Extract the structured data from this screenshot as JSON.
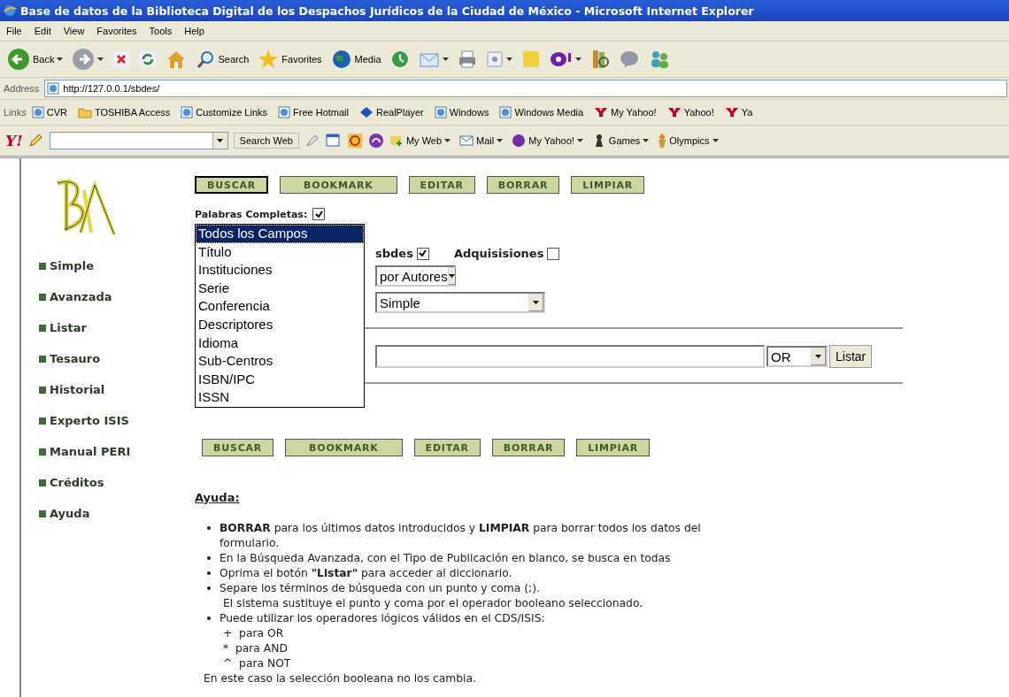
{
  "window": {
    "title": "Base de datos de la Biblioteca Digital de los Despachos Jurídicos de la Ciudad de México - Microsoft Internet Explorer"
  },
  "menu": [
    "File",
    "Edit",
    "View",
    "Favorites",
    "Tools",
    "Help"
  ],
  "toolbar": [
    {
      "kind": "back",
      "label": "Back",
      "dropdown": true
    },
    {
      "kind": "forward",
      "dropdown": true
    },
    {
      "kind": "stop"
    },
    {
      "kind": "refresh"
    },
    {
      "kind": "home"
    },
    {
      "kind": "search",
      "label": "Search"
    },
    {
      "kind": "favorites",
      "label": "Favorites"
    },
    {
      "kind": "media",
      "label": "Media"
    },
    {
      "kind": "history"
    },
    {
      "kind": "mail",
      "dropdown": true
    },
    {
      "kind": "print"
    },
    {
      "kind": "edit",
      "dropdown": true
    },
    {
      "kind": "note"
    },
    {
      "kind": "messenger",
      "dropdown": true
    },
    {
      "kind": "research"
    },
    {
      "kind": "discuss"
    },
    {
      "kind": "contacts"
    }
  ],
  "address": {
    "label": "Address",
    "value": "http://127.0.0.1/sbdes/"
  },
  "links": {
    "label": "Links",
    "items": [
      {
        "kind": "page",
        "label": "CVR"
      },
      {
        "kind": "folder",
        "label": "TOSHIBA Access"
      },
      {
        "kind": "page",
        "label": "Customize Links"
      },
      {
        "kind": "page",
        "label": "Free Hotmail"
      },
      {
        "kind": "real",
        "label": "RealPlayer"
      },
      {
        "kind": "page",
        "label": "Windows"
      },
      {
        "kind": "page",
        "label": "Windows Media"
      },
      {
        "kind": "yahoo",
        "label": "My Yahoo!"
      },
      {
        "kind": "yahoo",
        "label": "Yahoo!"
      },
      {
        "kind": "yahoo",
        "label": "Ya"
      }
    ]
  },
  "yahoo_bar": {
    "logo": "Y!",
    "search_button": "Search Web",
    "items": [
      {
        "kind": "myweb",
        "label": "My Web"
      },
      {
        "kind": "mail",
        "label": "Mail"
      },
      {
        "kind": "my",
        "label": "My Yahoo!"
      },
      {
        "kind": "games",
        "label": "Games"
      },
      {
        "kind": "olympics",
        "label": "Olympics"
      }
    ]
  },
  "nav": [
    "Simple",
    "Avanzada",
    "Listar",
    "Tesauro",
    "Historial",
    "Experto ISIS",
    "Manual PERI",
    "Créditos",
    "Ayuda"
  ],
  "buttons_top": [
    {
      "label": "BUSCAR",
      "focused": true
    },
    {
      "label": "BOOKMARK",
      "focused": false
    },
    {
      "label": "EDITAR",
      "focused": false
    },
    {
      "label": "BORRAR",
      "focused": false
    },
    {
      "label": "LIMPIAR",
      "focused": false
    }
  ],
  "palabras": {
    "label": "Palabras Completas:",
    "checked": true
  },
  "field_list": [
    {
      "label": "Todos los Campos",
      "selected": true
    },
    {
      "label": "Título",
      "selected": false
    },
    {
      "label": "Instituciones",
      "selected": false
    },
    {
      "label": "Serie",
      "selected": false
    },
    {
      "label": "Conferencia",
      "selected": false
    },
    {
      "label": "Descriptores",
      "selected": false
    },
    {
      "label": "Idioma",
      "selected": false
    },
    {
      "label": "Sub-Centros",
      "selected": false
    },
    {
      "label": "ISBN/IPC",
      "selected": false
    },
    {
      "label": "ISSN",
      "selected": false
    }
  ],
  "databases": [
    {
      "label": "sbdes",
      "checked": true
    },
    {
      "label": "Adquisisiones",
      "checked": false
    }
  ],
  "order_select": "por Autores",
  "type_select": "Simple",
  "operator_select": "OR",
  "listar_button": "Listar",
  "buttons_bottom": [
    {
      "label": "BUSCAR",
      "focused": false
    },
    {
      "label": "BOOKMARK",
      "focused": false
    },
    {
      "label": "EDITAR",
      "focused": false
    },
    {
      "label": "BORRAR",
      "focused": false
    },
    {
      "label": "LIMPIAR",
      "focused": false
    }
  ],
  "help": {
    "title": "Ayuda:",
    "items": [
      {
        "text": "**BORRAR** para los últimos datos introducidos y **LIMPIAR** para borrar todos los datos del formulario."
      },
      {
        "text": "En la Búsqueda Avanzada, con el Tipo de Publicación en blanco, se busca en todas"
      },
      {
        "text": "Oprima el botón **\"Listar\"** para acceder al diccionario."
      },
      {
        "text": "Separe los términos de búsqueda con un punto y coma (;).",
        "lines": [
          "El sistema sustituye el punto y coma por el operador booleano seleccionado."
        ]
      },
      {
        "text": "Puede utilizar los operadores lógicos válidos en el CDS/ISIS:",
        "lines": [
          "+  para OR",
          "*  para AND",
          "^  para NOT"
        ]
      }
    ],
    "footer_line": "En este caso la selección booleana no los cambia."
  }
}
